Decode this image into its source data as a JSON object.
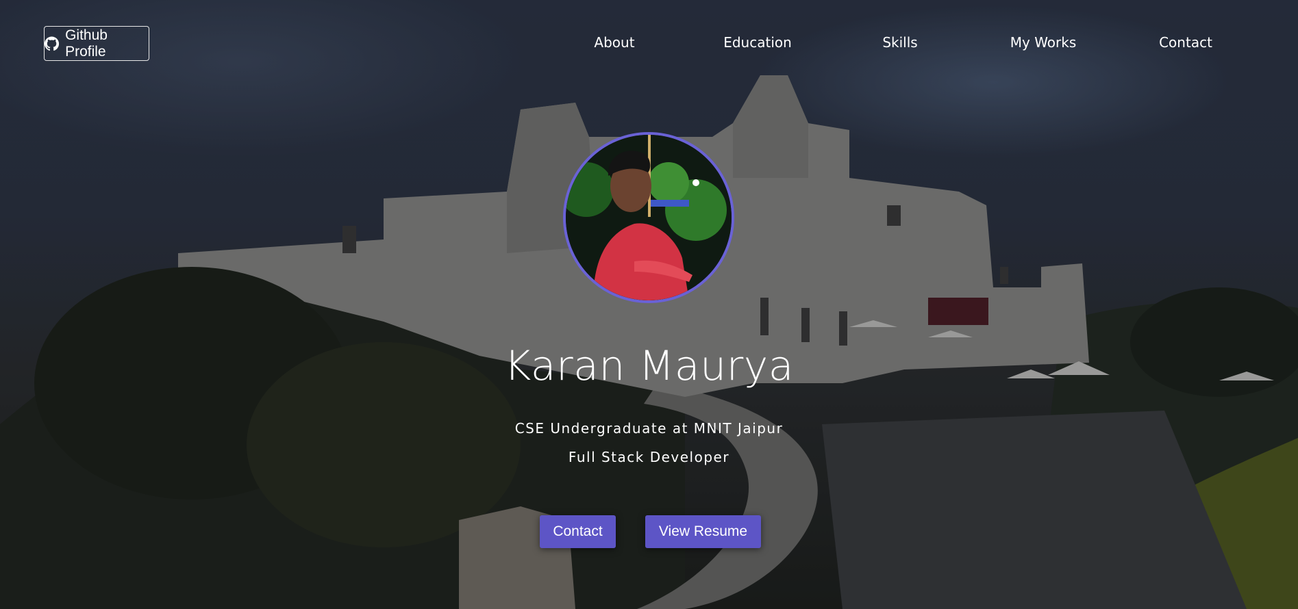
{
  "header": {
    "github_label": "Github Profile"
  },
  "nav": {
    "items": [
      "About",
      "Education",
      "Skills",
      "My Works",
      "Contact"
    ]
  },
  "hero": {
    "name": "Karan Maurya",
    "subtitle_1": "CSE Undergraduate at MNIT Jaipur",
    "subtitle_2": "Full Stack Developer",
    "contact_button": "Contact",
    "resume_button": "View Resume"
  },
  "colors": {
    "accent": "#5d55c6",
    "avatar_border": "#6a62d6"
  }
}
